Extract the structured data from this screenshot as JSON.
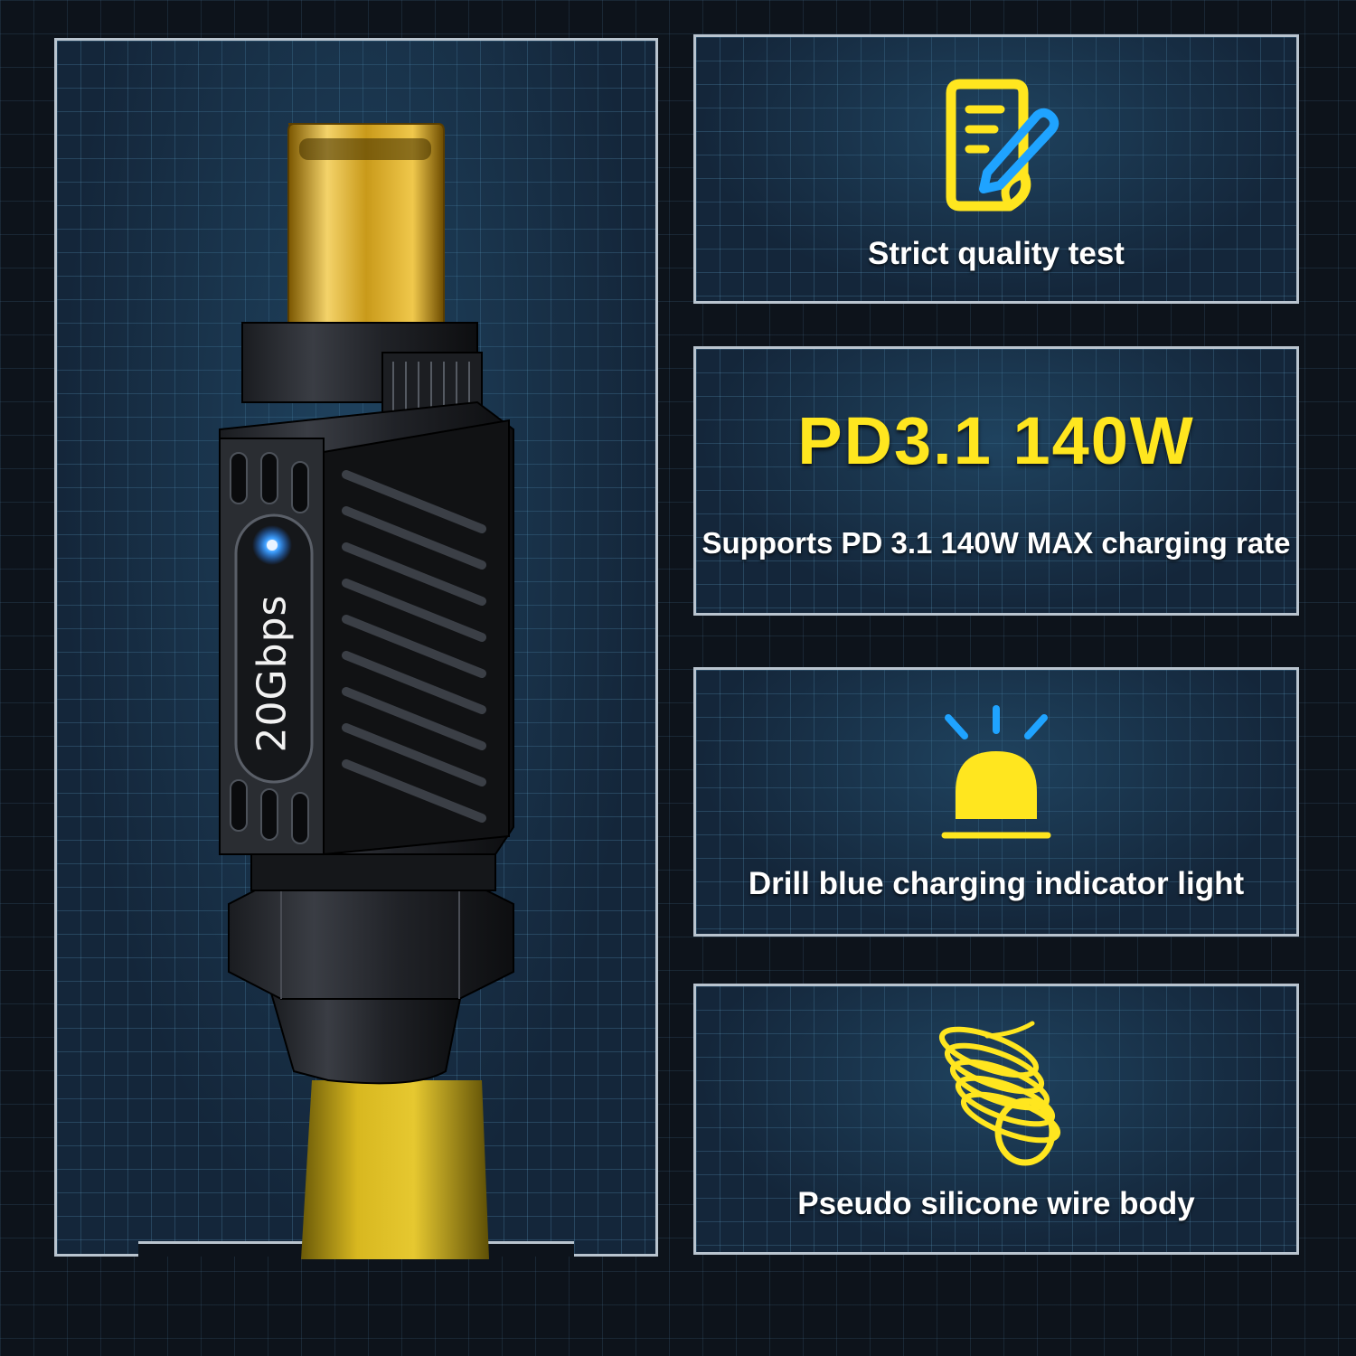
{
  "product": {
    "speed_label": "20Gbps",
    "indicator_color": "#3ea0ff",
    "cable_color": "#d8b820"
  },
  "features": [
    {
      "icon": "document-pen-icon",
      "caption": "Strict quality test"
    },
    {
      "icon": "power-rating",
      "headline": "PD3.1 140W",
      "caption": "Supports PD 3.1 140W MAX charging rate"
    },
    {
      "icon": "alarm-light-icon",
      "caption": "Drill blue charging indicator light"
    },
    {
      "icon": "coil-wire-icon",
      "caption": "Pseudo silicone wire body"
    }
  ],
  "colors": {
    "accent_yellow": "#ffe61f",
    "accent_blue": "#1fa3ff",
    "panel_border": "#b9c4cf"
  }
}
